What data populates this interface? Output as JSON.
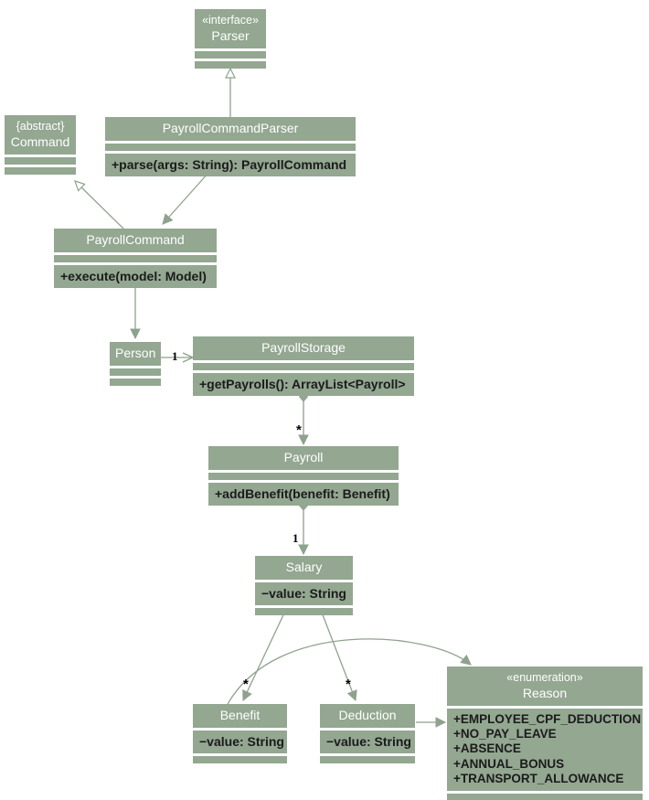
{
  "diagram": {
    "kind": "uml-class-diagram",
    "palette": {
      "class_fill": "#93a791",
      "separator": "#ffffff",
      "title_text": "#ffffff",
      "member_text": "#1b1b1b",
      "edge_line": "#8fa28d",
      "background": "#ffffff"
    }
  },
  "classes": {
    "parser": {
      "stereotype": "«interface»",
      "name": "Parser",
      "attributes": [],
      "operations": []
    },
    "command": {
      "stereotype": "{abstract}",
      "name": "Command",
      "attributes": [],
      "operations": []
    },
    "payroll_command_parser": {
      "name": "PayrollCommandParser",
      "operations": [
        "+parse(args: String): PayrollCommand"
      ]
    },
    "payroll_command": {
      "name": "PayrollCommand",
      "operations": [
        "+execute(model: Model)"
      ]
    },
    "person": {
      "name": "Person",
      "attributes": [],
      "operations": []
    },
    "payroll_storage": {
      "name": "PayrollStorage",
      "operations": [
        "+getPayrolls(): ArrayList<Payroll>"
      ]
    },
    "payroll": {
      "name": "Payroll",
      "operations": [
        "+addBenefit(benefit: Benefit)"
      ]
    },
    "salary": {
      "name": "Salary",
      "attributes": [
        "−value: String"
      ],
      "operations": []
    },
    "benefit": {
      "name": "Benefit",
      "attributes": [
        "−value: String"
      ],
      "operations": []
    },
    "deduction": {
      "name": "Deduction",
      "attributes": [
        "−value: String"
      ],
      "operations": []
    },
    "reason": {
      "stereotype": "«enumeration»",
      "name": "Reason",
      "values": [
        "+EMPLOYEE_CPF_DEDUCTION",
        "+NO_PAY_LEAVE",
        "+ABSENCE",
        "+ANNUAL_BONUS",
        "+TRANSPORT_ALLOWANCE"
      ]
    }
  },
  "multiplicities": {
    "person_to_storage": "1",
    "storage_to_payroll": "*",
    "payroll_to_salary": "1",
    "salary_to_benefit": "*",
    "salary_to_deduction": "*"
  },
  "relationships": [
    {
      "from": "PayrollCommandParser",
      "to": "Parser",
      "type": "realization"
    },
    {
      "from": "PayrollCommand",
      "to": "Command",
      "type": "realization"
    },
    {
      "from": "PayrollCommandParser",
      "to": "PayrollCommand",
      "type": "dependency"
    },
    {
      "from": "PayrollCommand",
      "to": "Person",
      "type": "dependency"
    },
    {
      "from": "Person",
      "to": "PayrollStorage",
      "type": "dependency",
      "label": "1"
    },
    {
      "from": "PayrollStorage",
      "to": "Payroll",
      "type": "aggregation",
      "label": "*"
    },
    {
      "from": "Payroll",
      "to": "Salary",
      "type": "aggregation",
      "label": "1"
    },
    {
      "from": "Salary",
      "to": "Benefit",
      "type": "aggregation",
      "label": "*"
    },
    {
      "from": "Salary",
      "to": "Deduction",
      "type": "aggregation",
      "label": "*"
    },
    {
      "from": "Benefit",
      "to": "Reason",
      "type": "dependency"
    },
    {
      "from": "Deduction",
      "to": "Reason",
      "type": "dependency"
    }
  ]
}
